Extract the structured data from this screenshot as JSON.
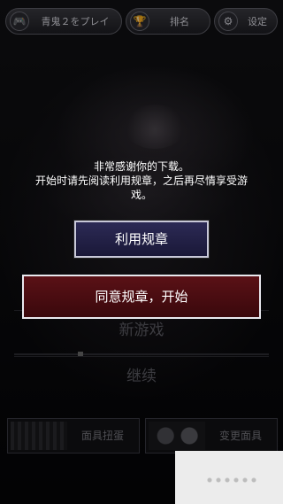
{
  "topbar": {
    "play": {
      "label": "青鬼２をプレイ",
      "icon": "gamepad-icon"
    },
    "rank": {
      "label": "排名",
      "icon": "trophy-icon"
    },
    "settings": {
      "label": "设定",
      "icon": "gear-icon"
    }
  },
  "notice": {
    "lines": [
      "非常感谢你的下载。",
      "开始时请先阅读利用规章，之后再尽情享受游",
      "戏。"
    ]
  },
  "buttons": {
    "rules": "利用规章",
    "agree": "同意规章，开始"
  },
  "menu": {
    "new_game": "新游戏",
    "continue": "继续"
  },
  "bottom": {
    "gacha": "面具扭蛋",
    "mask_change": "变更面具"
  },
  "colors": {
    "agree_bg": "#4a0d12",
    "rules_bg": "#241f4a"
  }
}
